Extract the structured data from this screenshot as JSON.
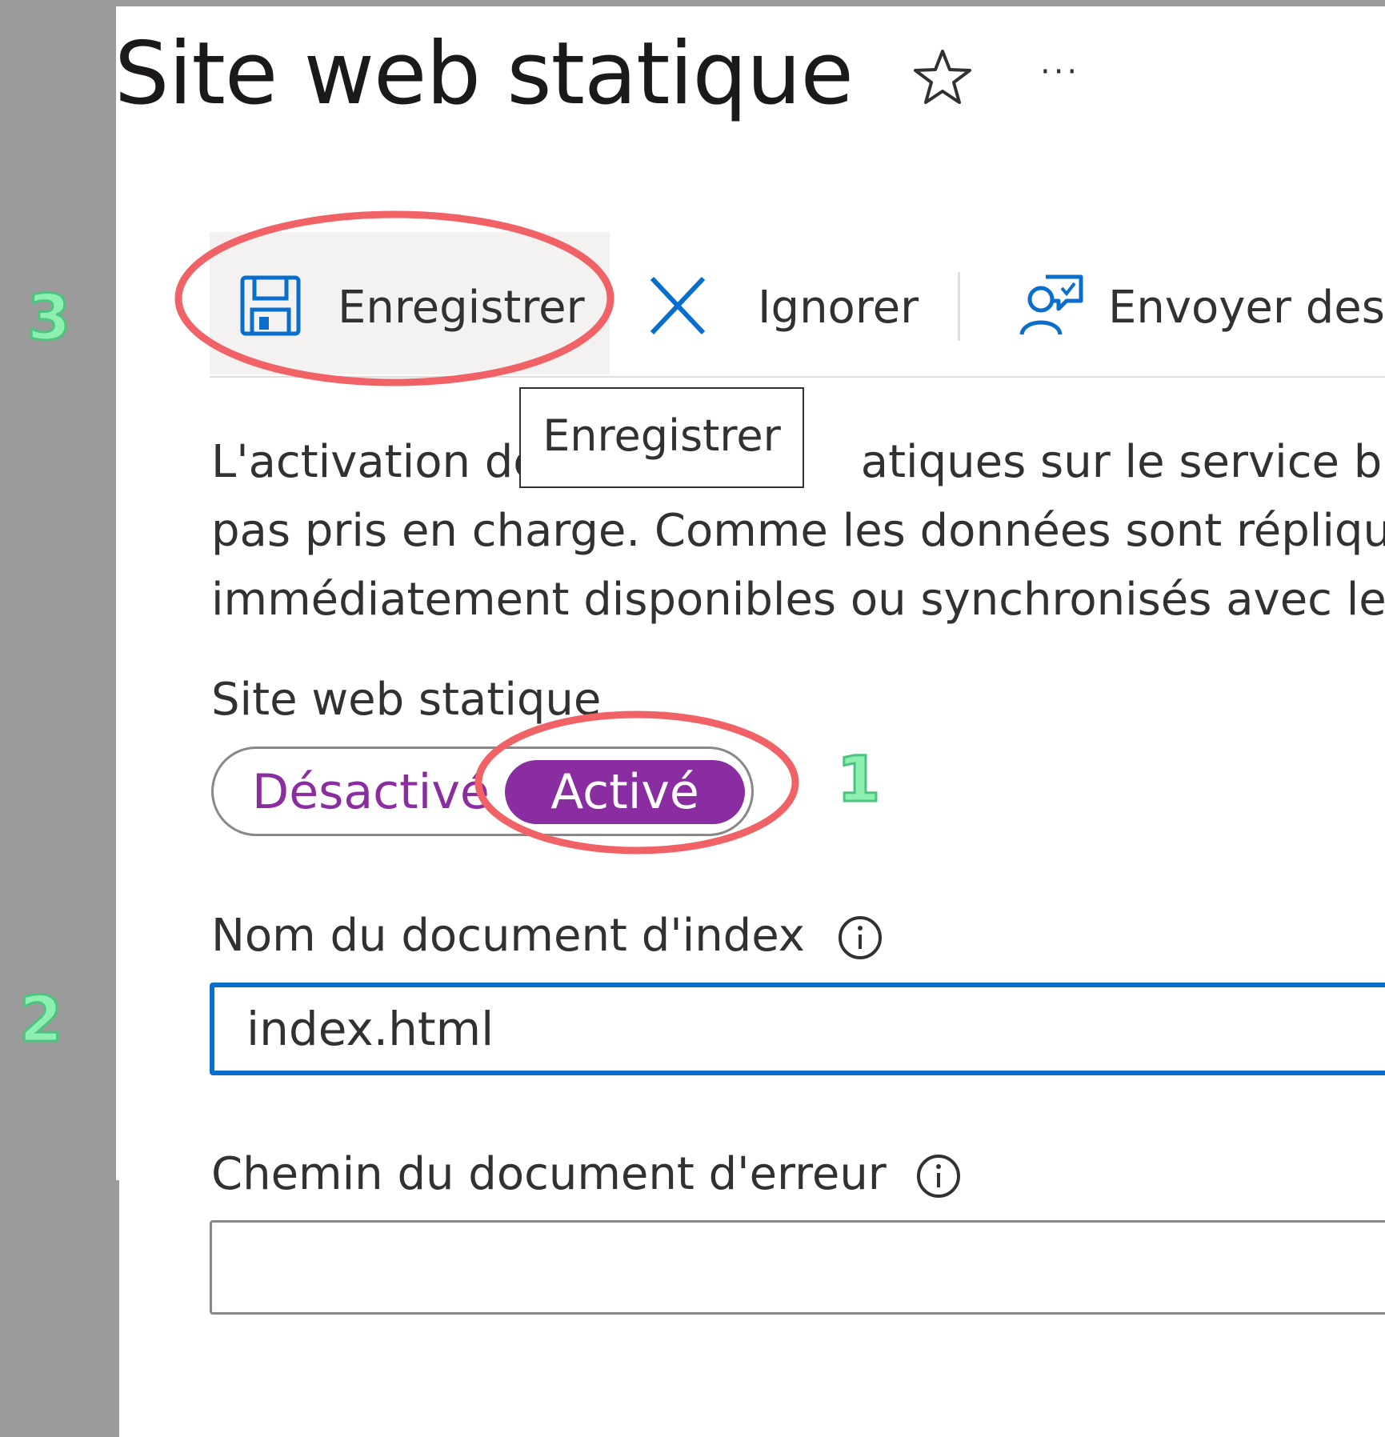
{
  "header": {
    "title": "Site web statique",
    "favorite_icon": "star-icon",
    "more_label": "···"
  },
  "toolbar": {
    "save_label": "Enregistrer",
    "save_icon": "save-icon",
    "ignore_label": "Ignorer",
    "ignore_icon": "close-icon",
    "feedback_label": "Envoyer des",
    "feedback_icon": "feedback-icon"
  },
  "tooltip": {
    "text": "Enregistrer"
  },
  "info": {
    "line1": "L'activation de",
    "line1_rest": "atiques sur le service blob",
    "line2": "pas pris en charge. Comme les données sont répliqu",
    "line3": "immédiatement disponibles ou synchronisés avec les"
  },
  "static_website": {
    "label": "Site web statique",
    "off_label": "Désactivé",
    "on_label": "Activé",
    "selected": "Activé"
  },
  "index_document": {
    "label": "Nom du document d'index",
    "value": "index.html"
  },
  "error_document": {
    "label": "Chemin du document d'erreur",
    "value": ""
  },
  "annotations": {
    "step1": "1",
    "step2": "2",
    "step3": "3"
  },
  "colors": {
    "accent_purple": "#8a2da0",
    "input_focus_blue": "#0a6ecd",
    "annotation_red": "#f06266",
    "annotation_green": "#8ef0b0"
  }
}
